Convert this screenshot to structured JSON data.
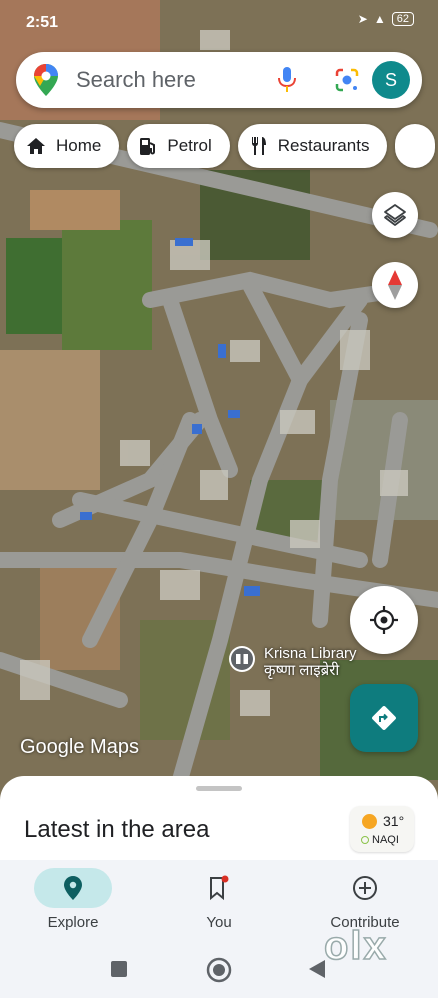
{
  "status_bar": {
    "time": "2:51",
    "battery": "62"
  },
  "search": {
    "placeholder": "Search here",
    "avatar_letter": "S"
  },
  "chips": [
    {
      "label": "Home",
      "icon": "home-icon"
    },
    {
      "label": "Petrol",
      "icon": "fuel-icon"
    },
    {
      "label": "Restaurants",
      "icon": "restaurant-icon"
    }
  ],
  "map": {
    "poi": {
      "name": "Krisna Library",
      "name_local": "कृष्णा लाइब्रेरी",
      "icon": "library-icon"
    },
    "attribution": "Google Maps"
  },
  "sheet": {
    "title": "Latest in the area"
  },
  "weather": {
    "temperature": "31°",
    "aqi_label": "NAQI"
  },
  "bottom_nav": [
    {
      "label": "Explore",
      "icon": "explore-pin-icon",
      "active": true
    },
    {
      "label": "You",
      "icon": "bookmark-icon",
      "active": false
    },
    {
      "label": "Contribute",
      "icon": "add-circle-icon",
      "active": false
    }
  ],
  "watermark": "olx",
  "colors": {
    "accent": "#0e7c7e",
    "active_nav": "#c5e8ea"
  }
}
